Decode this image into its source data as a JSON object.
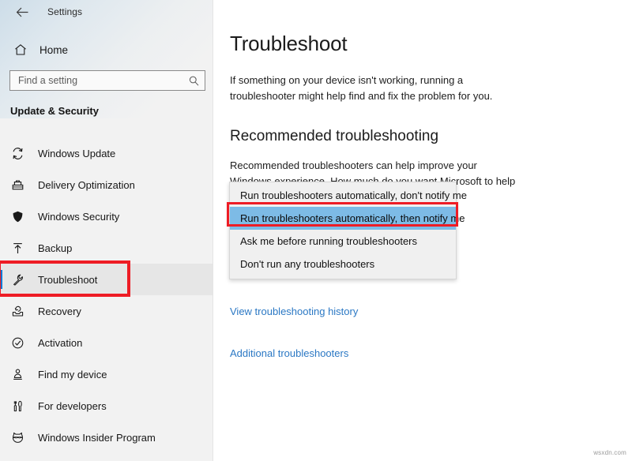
{
  "window": {
    "app_title": "Settings",
    "back_icon": "back-arrow-icon"
  },
  "sidebar": {
    "home_label": "Home",
    "home_icon": "home-icon",
    "search": {
      "placeholder": "Find a setting",
      "value": "",
      "icon": "search-icon"
    },
    "section_header": "Update & Security",
    "items": [
      {
        "label": "Windows Update",
        "icon": "sync-icon",
        "selected": false
      },
      {
        "label": "Delivery Optimization",
        "icon": "delivery-box-icon",
        "selected": false
      },
      {
        "label": "Windows Security",
        "icon": "shield-icon",
        "selected": false
      },
      {
        "label": "Backup",
        "icon": "upload-icon",
        "selected": false
      },
      {
        "label": "Troubleshoot",
        "icon": "wrench-icon",
        "selected": true
      },
      {
        "label": "Recovery",
        "icon": "recovery-tray-icon",
        "selected": false
      },
      {
        "label": "Activation",
        "icon": "check-circle-icon",
        "selected": false
      },
      {
        "label": "Find my device",
        "icon": "person-locate-icon",
        "selected": false
      },
      {
        "label": "For developers",
        "icon": "developer-tools-icon",
        "selected": false
      },
      {
        "label": "Windows Insider Program",
        "icon": "ninjacat-icon",
        "selected": false
      }
    ]
  },
  "main": {
    "page_title": "Troubleshoot",
    "page_description": "If something on your device isn't working, running a troubleshooter might help find and fix the problem for you.",
    "subsection_title": "Recommended troubleshooting",
    "subsection_description": "Recommended troubleshooters can help improve your Windows experience. How much do you want Microsoft to help when we find problems we're able to fix?",
    "dropdown": {
      "expanded": true,
      "selected_value": "Run troubleshooters automatically, then notify me",
      "options": [
        "Run troubleshooters automatically, don't notify me",
        "Run troubleshooters automatically, then notify me",
        "Ask me before running troubleshooters",
        "Don't run any troubleshooters"
      ]
    },
    "links": [
      {
        "label": "View troubleshooting history"
      },
      {
        "label": "Additional troubleshooters"
      }
    ]
  },
  "annotations": {
    "highlight_color": "#EE1C25",
    "selection_color": "#0078D7",
    "dropdown_highlight_color": "#7DBBE6",
    "link_color": "#2B78C4"
  },
  "watermark": {
    "text": "wsxdn.com"
  }
}
